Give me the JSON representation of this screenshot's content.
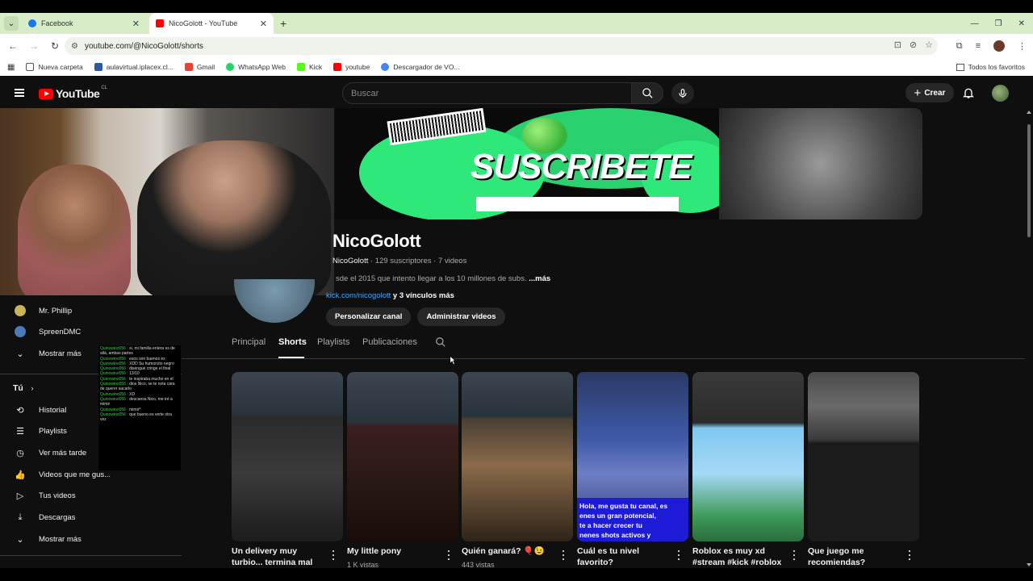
{
  "browser": {
    "tabs": [
      {
        "title": "Facebook",
        "active": false,
        "favicon_color": "#1877f2"
      },
      {
        "title": "NicoGolott - YouTube",
        "active": true,
        "favicon_color": "#ff0000"
      }
    ],
    "url": "youtube.com/@NicoGolott/shorts",
    "bookmarks": [
      "Nueva carpeta",
      "aulavirtual.iplacex.cl...",
      "Gmail",
      "WhatsApp Web",
      "Kick",
      "youtube",
      "Descargador de VO..."
    ],
    "all_favorites": "Todos los favoritos"
  },
  "youtube": {
    "logo": "YouTube",
    "country": "CL",
    "search_placeholder": "Buscar",
    "create_label": "Crear"
  },
  "banner": {
    "text": "SUSCRIBETE"
  },
  "channel": {
    "name": "NicoGolott",
    "handle": "NicoGolott",
    "meta": " · 129 suscriptores · 7 videos",
    "description": "sde el 2015 que intento llegar a los 10 millones de subs. ",
    "more": "...más",
    "link": "kick.com/nicogolott",
    "more_links": " y 3 vínculos más",
    "btn_customize": "Personalizar canal",
    "btn_manage": "Administrar videos"
  },
  "nav_tabs": [
    "Principal",
    "Shorts",
    "Playlists",
    "Publicaciones"
  ],
  "sidebar": {
    "subscriptions": [
      {
        "label": "Mr. Phillip",
        "color": "#c8b45a"
      },
      {
        "label": "SpreenDMC",
        "color": "#4a7ab8"
      }
    ],
    "show_more": "Mostrar más",
    "you_label": "Tú",
    "you_items": [
      "Historial",
      "Playlists",
      "Ver más tarde",
      "Videos que me gus...",
      "Tus videos",
      "Descargas"
    ],
    "show_more_2": "Mostrar más"
  },
  "chat": [
    {
      "user": "Quinowino056 :",
      "text": " si, mi familia entera es de allá, ambas partes"
    },
    {
      "user": "Quinowino056 :",
      "text": " esos son buenos ex"
    },
    {
      "user": "Quinowino056 :",
      "text": " XDD Su humorcito negro"
    },
    {
      "user": "Quinowino056 :",
      "text": " disengue cringe el final"
    },
    {
      "user": "Quinowino056 :",
      "text": " 13/10"
    },
    {
      "user": "Quinowino056 :",
      "text": " te inspiraba mucho en el"
    },
    {
      "user": "Quinowino056 :",
      "text": " dios Nico, se te nota cara de querer sacarlo"
    },
    {
      "user": "Quinowino056 :",
      "text": " XD"
    },
    {
      "user": "Quinowino056 :",
      "text": " descansa Nico, me iré a mimir"
    },
    {
      "user": "Quinowino056 :",
      "text": " mimir*"
    },
    {
      "user": "Quinowino056 :",
      "text": " que bueno es verte otra vez"
    }
  ],
  "shorts": [
    {
      "title": "Un delivery muy turbio... termina mal",
      "views": ""
    },
    {
      "title": "My little pony",
      "views": "1 K vistas"
    },
    {
      "title": "Quién ganará? 🎈😉",
      "views": "443 vistas"
    },
    {
      "title": "Cuál es tu nivel favorito?",
      "views": ""
    },
    {
      "title": "Roblox es muy xd #stream #kick #roblox",
      "views": ""
    },
    {
      "title": "Que juego me recomiendas?",
      "views": ""
    }
  ],
  "short4_caption": "Hola, me gusta tu canal, es\nenes un gran potencial,\nte a hacer crecer tu\nnenes shots activos y"
}
